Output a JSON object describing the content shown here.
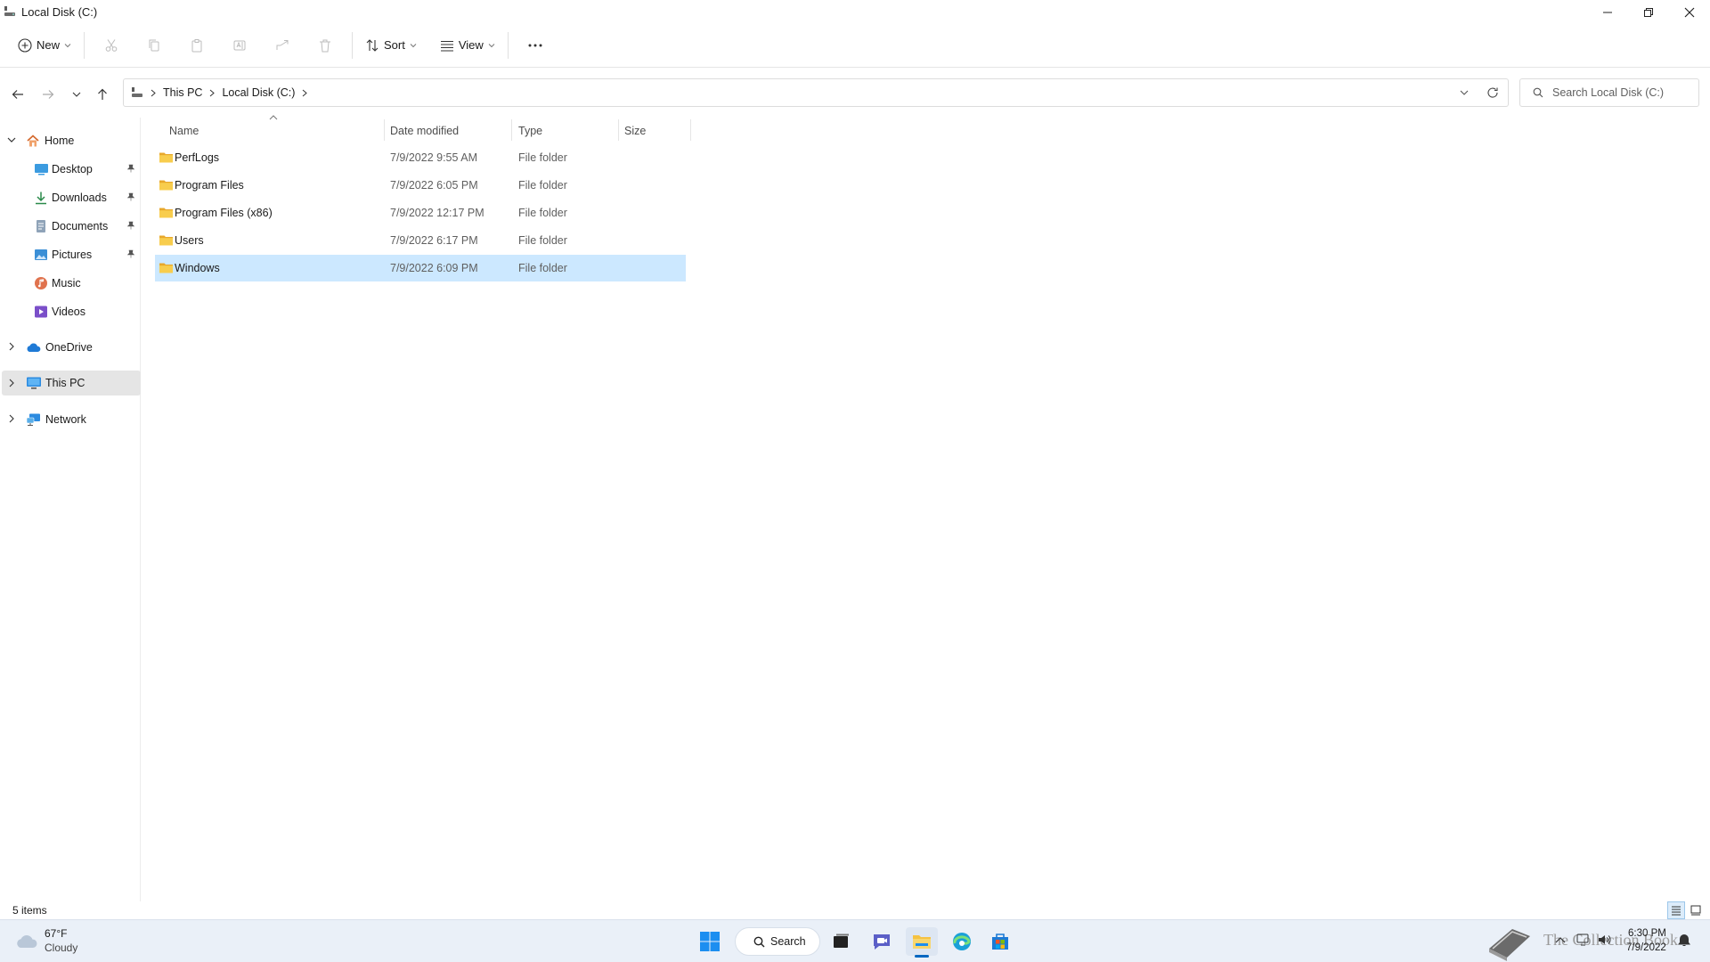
{
  "window": {
    "title": "Local Disk (C:)"
  },
  "toolbar": {
    "new_label": "New",
    "sort_label": "Sort",
    "view_label": "View"
  },
  "address": {
    "crumbs": [
      "This PC",
      "Local Disk (C:)"
    ],
    "search_placeholder": "Search Local Disk (C:)"
  },
  "sidebar": {
    "home": "Home",
    "items": [
      {
        "label": "Desktop",
        "pinned": true,
        "icon": "desktop-icon"
      },
      {
        "label": "Downloads",
        "pinned": true,
        "icon": "downloads-icon"
      },
      {
        "label": "Documents",
        "pinned": true,
        "icon": "documents-icon"
      },
      {
        "label": "Pictures",
        "pinned": true,
        "icon": "pictures-icon"
      },
      {
        "label": "Music",
        "pinned": false,
        "icon": "music-icon"
      },
      {
        "label": "Videos",
        "pinned": false,
        "icon": "videos-icon"
      }
    ],
    "onedrive": "OneDrive",
    "thispc": "This PC",
    "network": "Network"
  },
  "filelist": {
    "columns": {
      "name": "Name",
      "date": "Date modified",
      "type": "Type",
      "size": "Size"
    },
    "rows": [
      {
        "name": "PerfLogs",
        "date": "7/9/2022 9:55 AM",
        "type": "File folder",
        "size": ""
      },
      {
        "name": "Program Files",
        "date": "7/9/2022 6:05 PM",
        "type": "File folder",
        "size": ""
      },
      {
        "name": "Program Files (x86)",
        "date": "7/9/2022 12:17 PM",
        "type": "File folder",
        "size": ""
      },
      {
        "name": "Users",
        "date": "7/9/2022 6:17 PM",
        "type": "File folder",
        "size": ""
      },
      {
        "name": "Windows",
        "date": "7/9/2022 6:09 PM",
        "type": "File folder",
        "size": ""
      }
    ],
    "selected_row": "Windows"
  },
  "status": {
    "item_count": "5 items"
  },
  "taskbar": {
    "weather_temp": "67°F",
    "weather_desc": "Cloudy",
    "search_label": "Search",
    "watermark": "The Collection Book",
    "time": "6:30 PM",
    "date": "7/9/2022"
  },
  "colors": {
    "selection": "#cce8ff",
    "folder": "#f5c242",
    "accent": "#0067c0",
    "taskbar_bg": "#eaf0f8"
  }
}
